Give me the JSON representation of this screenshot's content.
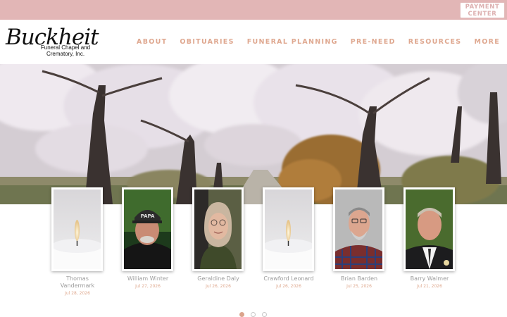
{
  "topbar": {
    "payment_line1": "PAYMENT",
    "payment_line2": "CENTER"
  },
  "logo": {
    "script": "Buckheit",
    "sub_line1": "Funeral Chapel and",
    "sub_line2": "Crematory, Inc."
  },
  "nav": [
    {
      "label": "ABOUT"
    },
    {
      "label": "OBITUARIES"
    },
    {
      "label": "FUNERAL PLANNING"
    },
    {
      "label": "PRE-NEED"
    },
    {
      "label": "RESOURCES"
    },
    {
      "label": "MORE"
    }
  ],
  "obituaries": [
    {
      "name_line1": "Thomas",
      "name_line2": "Vandermark",
      "date": "Jul 28, 2026",
      "photo": "candle"
    },
    {
      "name_line1": "William Winter",
      "name_line2": "",
      "date": "Jul 27, 2026",
      "photo": "portrait-cap"
    },
    {
      "name_line1": "Geraldine Daly",
      "name_line2": "",
      "date": "Jul 26, 2026",
      "photo": "portrait-woman"
    },
    {
      "name_line1": "Crawford Leonard",
      "name_line2": "",
      "date": "Jul 26, 2026",
      "photo": "candle"
    },
    {
      "name_line1": "Brian Barden",
      "name_line2": "",
      "date": "Jul 25, 2026",
      "photo": "portrait-plaid"
    },
    {
      "name_line1": "Barry Walmer",
      "name_line2": "",
      "date": "Jul 21, 2026",
      "photo": "portrait-suit"
    }
  ],
  "colors": {
    "topbar": "#e2b6b6",
    "accent": "#dfa890",
    "name_text": "#9a9a9a"
  }
}
